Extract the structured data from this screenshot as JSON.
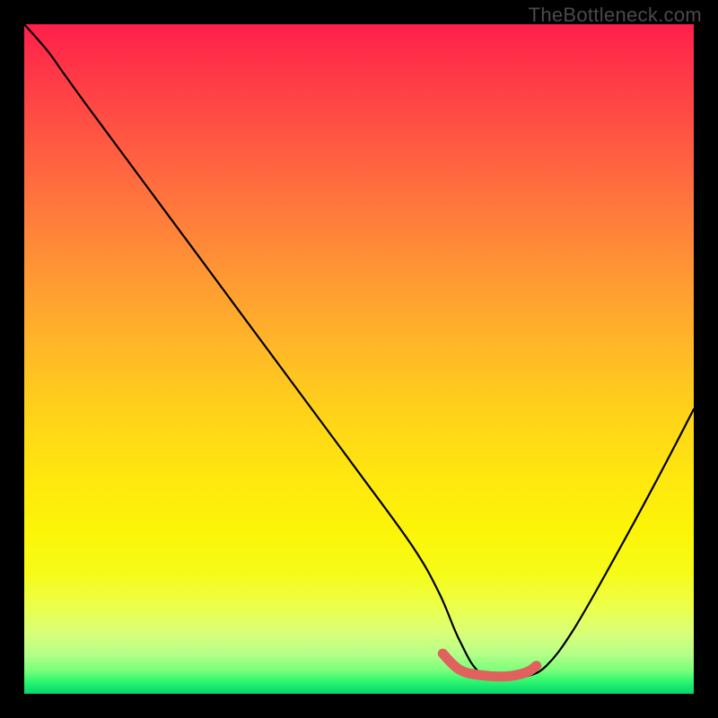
{
  "watermark": "TheBottleneck.com",
  "chart_data": {
    "type": "line",
    "title": "",
    "xlabel": "",
    "ylabel": "",
    "xlim": [
      0,
      100
    ],
    "ylim": [
      0,
      100
    ],
    "grid": false,
    "legend": false,
    "note": "Axes unlabeled; values are chart-relative percentages. y=0 is the bottom (green) edge, y=100 is the top (red) edge. The curve descends, flattens near the bottom around x≈65–75, then rises.",
    "series": [
      {
        "name": "curve",
        "color": "#000000",
        "x": [
          0,
          3.5,
          6,
          10,
          20,
          30,
          40,
          50,
          58,
          62,
          65,
          68,
          72,
          75,
          78,
          82,
          88,
          94,
          100
        ],
        "y": [
          100,
          96,
          92.5,
          87,
          73.5,
          60,
          46.5,
          33,
          22,
          15,
          8,
          3.2,
          2.4,
          2.6,
          4.2,
          9.5,
          20,
          31,
          42.5
        ]
      },
      {
        "name": "highlight-segment",
        "color": "#e0615e",
        "x": [
          62.5,
          65,
          68,
          72,
          75,
          76.5
        ],
        "y": [
          6.0,
          3.6,
          2.8,
          2.6,
          3.2,
          4.2
        ]
      }
    ],
    "gradient_stops": [
      {
        "pos": 0.0,
        "color": "#ff1f4b"
      },
      {
        "pos": 0.5,
        "color": "#ffc81e"
      },
      {
        "pos": 0.82,
        "color": "#f6fb18"
      },
      {
        "pos": 0.96,
        "color": "#7aff7c"
      },
      {
        "pos": 1.0,
        "color": "#0bd46e"
      }
    ]
  }
}
